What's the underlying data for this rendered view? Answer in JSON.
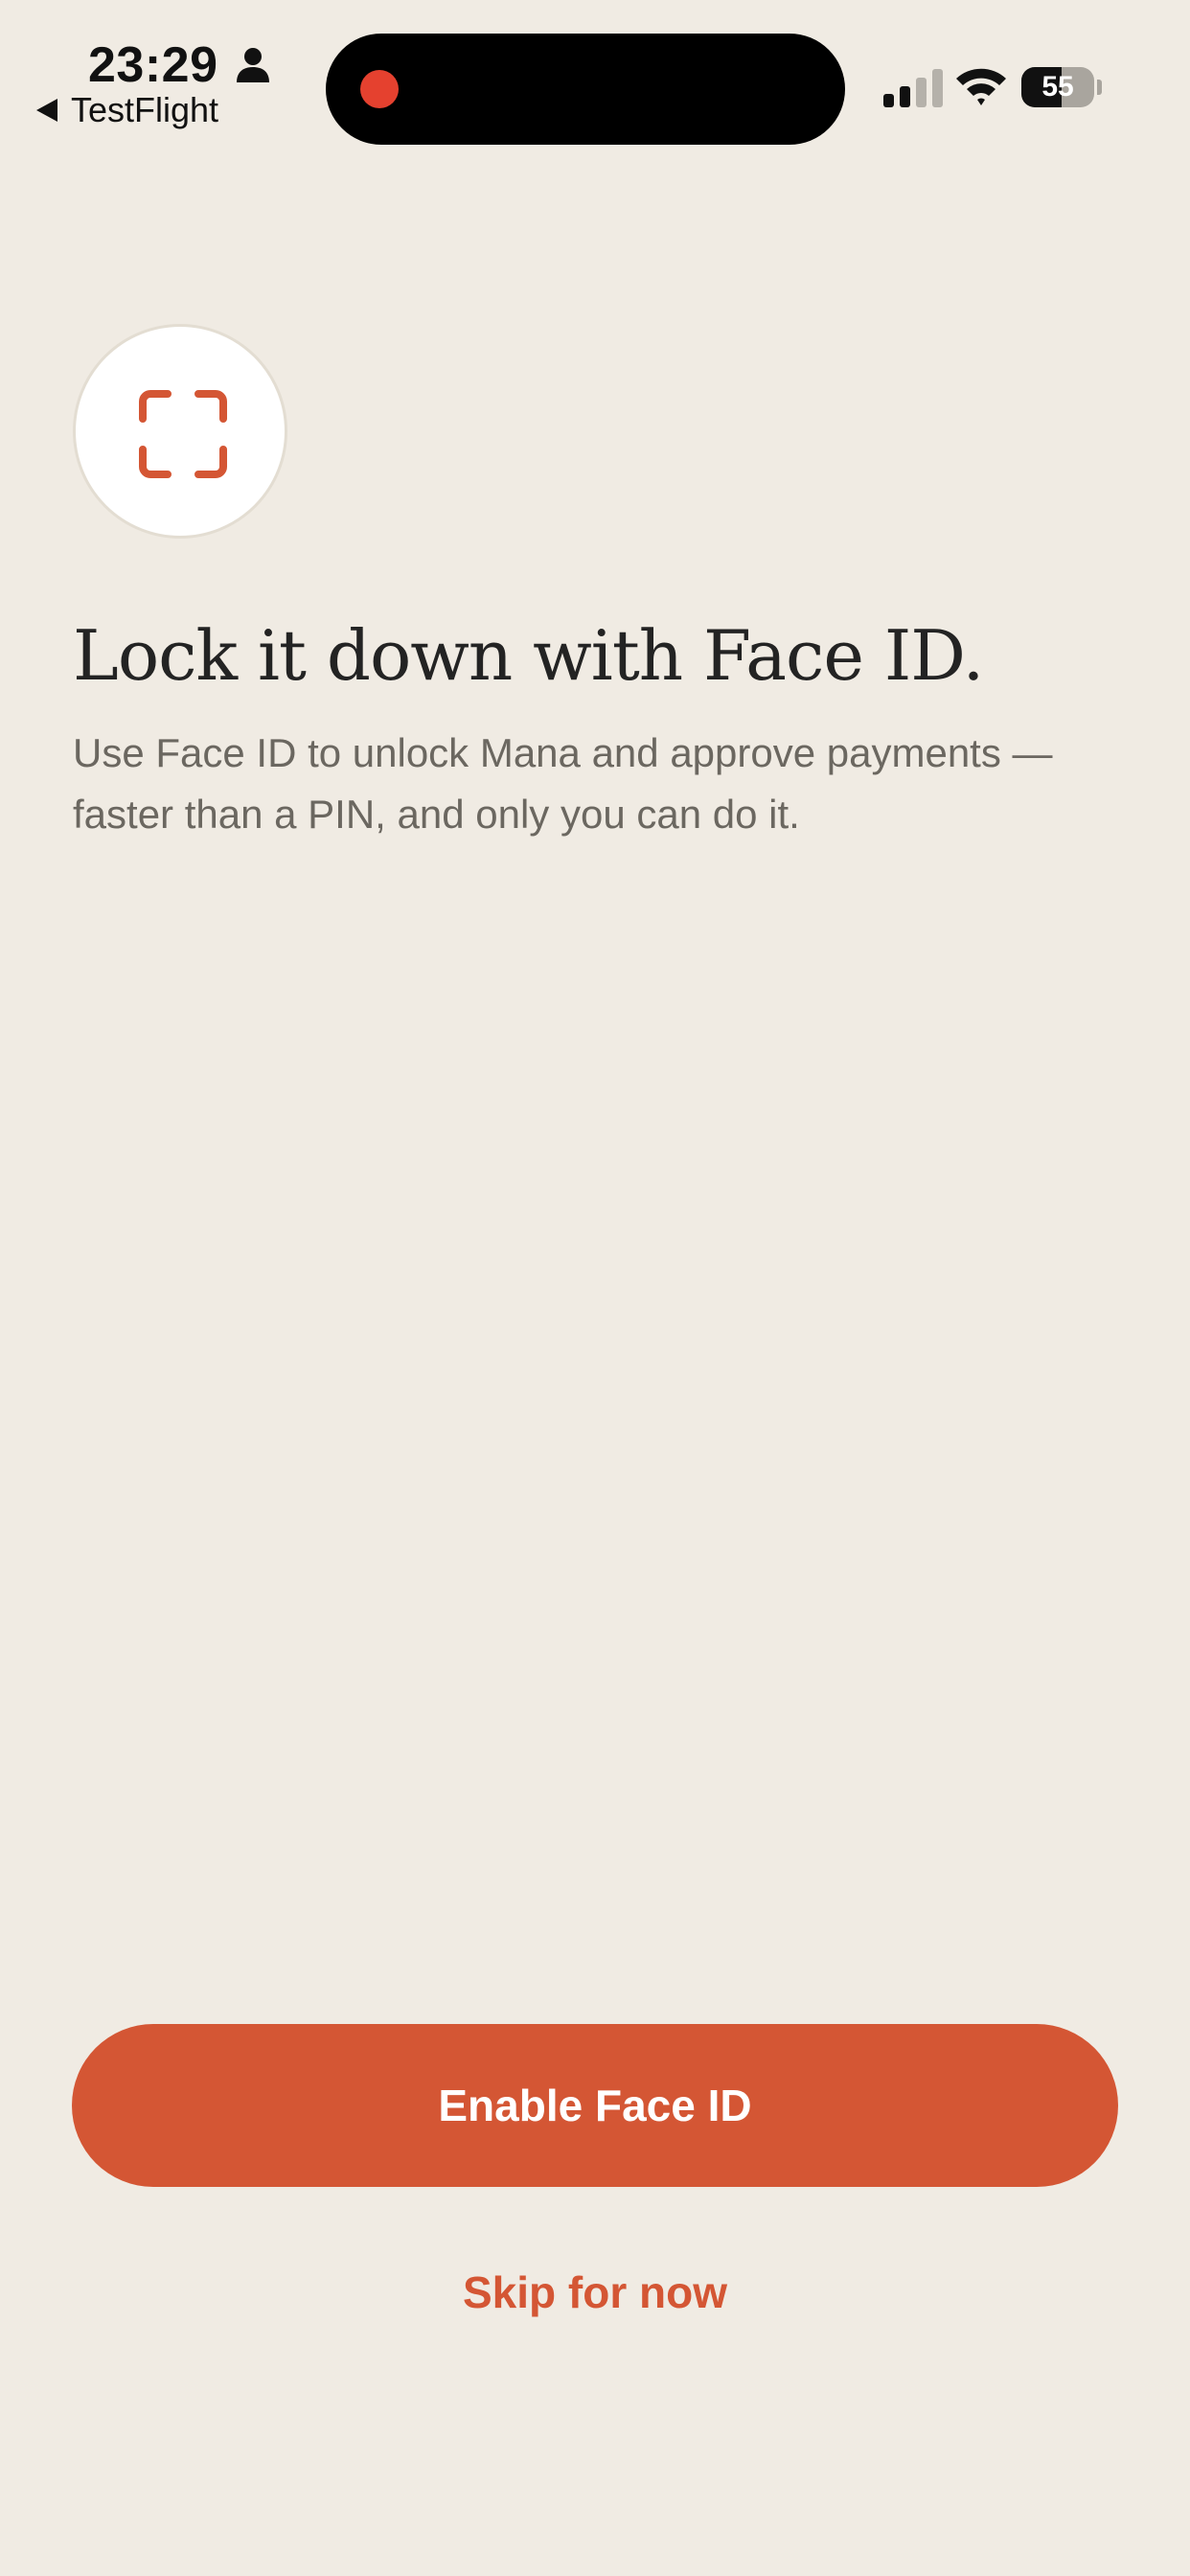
{
  "status_bar": {
    "time": "23:29",
    "back_label": "TestFlight",
    "battery_level": "55",
    "battery_fraction": 0.55,
    "recording_color": "#e5412f"
  },
  "icons": {
    "person": "person-icon",
    "back": "back-arrow-icon",
    "signal": "cellular-signal-icon",
    "wifi": "wifi-icon",
    "battery": "battery-icon",
    "faceid": "face-id-icon"
  },
  "main": {
    "title": "Lock it down with Face ID.",
    "subtitle": "Use Face ID to unlock Mana and approve payments — faster than a PIN, and only you can do it."
  },
  "actions": {
    "enable_label": "Enable Face ID",
    "skip_label": "Skip for now"
  },
  "colors": {
    "background": "#f0ebe3",
    "accent": "#d45634",
    "title": "#232323",
    "subtitle": "#6b6760"
  }
}
